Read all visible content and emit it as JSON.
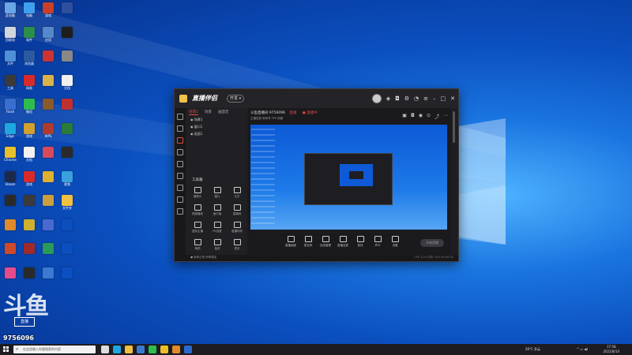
{
  "desktop": {
    "icons": [
      {
        "label": "此电脑",
        "color": "#6aa6e8"
      },
      {
        "label": "电脑",
        "color": "#3fa0f0"
      },
      {
        "label": "游戏",
        "color": "#c8402a"
      },
      {
        "label": "",
        "color": "#2f4f9e"
      },
      {
        "label": "回收站",
        "color": "#cfd6e0"
      },
      {
        "label": "软件",
        "color": "#2a8f4a"
      },
      {
        "label": "应用",
        "color": "#5588cc"
      },
      {
        "label": "",
        "color": "#1e1e1e"
      },
      {
        "label": "文件",
        "color": "#4f8fd8"
      },
      {
        "label": "浏览器",
        "color": "#2c5aa0"
      },
      {
        "label": "",
        "color": "#c33"
      },
      {
        "label": "",
        "color": "#888"
      },
      {
        "label": "工具",
        "color": "#3a3a3a"
      },
      {
        "label": "网易",
        "color": "#d82a2a"
      },
      {
        "label": "",
        "color": "#d9b24a"
      },
      {
        "label": "文档",
        "color": "#f0f0f0"
      },
      {
        "label": "Flash",
        "color": "#3a6ed0"
      },
      {
        "label": "微信",
        "color": "#2dbd4e"
      },
      {
        "label": "",
        "color": "#8a5a2a"
      },
      {
        "label": "",
        "color": "#c03030"
      },
      {
        "label": "Edge",
        "color": "#1ea7e0"
      },
      {
        "label": "游戏",
        "color": "#d0a030"
      },
      {
        "label": "WPS",
        "color": "#b03a2e"
      },
      {
        "label": "",
        "color": "#2a7a3a"
      },
      {
        "label": "Chrome",
        "color": "#e8c02a"
      },
      {
        "label": "文档",
        "color": "#f2f2f2"
      },
      {
        "label": "",
        "color": "#d84a5a"
      },
      {
        "label": "",
        "color": "#2a2a2a"
      },
      {
        "label": "Steam",
        "color": "#1b2a4a"
      },
      {
        "label": "游戏",
        "color": "#d82a2a"
      },
      {
        "label": "",
        "color": "#e0b030"
      },
      {
        "label": "视频",
        "color": "#3aa0e0"
      },
      {
        "label": "",
        "color": "#2a2a2a"
      },
      {
        "label": "",
        "color": "#3a3a3a"
      },
      {
        "label": "",
        "color": "#c8a040"
      },
      {
        "label": "文件夹",
        "color": "#f0c040"
      },
      {
        "label": "",
        "color": "#e08a2a"
      },
      {
        "label": "",
        "color": "#d0b030"
      },
      {
        "label": "",
        "color": "#4a6ad0"
      },
      {
        "label": "",
        "color": "#0b4fbf"
      },
      {
        "label": "",
        "color": "#d04a2a"
      },
      {
        "label": "",
        "color": "#a02a2a"
      },
      {
        "label": "",
        "color": "#2a9a5a"
      },
      {
        "label": "",
        "color": "#0b4fbf"
      },
      {
        "label": "",
        "color": "#e84a8a"
      },
      {
        "label": "",
        "color": "#2a2a2a"
      },
      {
        "label": "",
        "color": "#3a7ad0"
      },
      {
        "label": "",
        "color": "#0b4fbf"
      },
      {
        "label": "",
        "color": "#2a5aa0"
      },
      {
        "label": "",
        "color": "#c02a2a"
      },
      {
        "label": "",
        "color": "#a0a0a0"
      },
      {
        "label": "",
        "color": "#0b4fbf"
      },
      {
        "label": "QQ",
        "color": "#111"
      },
      {
        "label": "",
        "color": "#2a7a9a"
      },
      {
        "label": "",
        "color": "#e0e0e0"
      },
      {
        "label": "",
        "color": "#0b4fbf"
      }
    ],
    "watermark_text": "斗鱼",
    "watermark_tag": "直播",
    "watermark_number": "9756096"
  },
  "app": {
    "name": "直播伴侣",
    "version_badge": "开发 ▾",
    "titlebar_icons": [
      "avatar",
      "shirt-icon",
      "lock-icon",
      "settings-icon",
      "bell-icon",
      "menu-icon",
      "minimize-icon",
      "maximize-icon",
      "close-icon"
    ],
    "tabs": [
      "场景1",
      "场景",
      "画面音"
    ],
    "scenes": [
      "◉ 场景1",
      "◉ 窗口1",
      "◉ 画面1"
    ],
    "tools_title": "工具箱",
    "tools": [
      "摄像头",
      "图片",
      "文字",
      "视频播放",
      "画中画",
      "直播间",
      "虚拟主播",
      "PK连麦",
      "直播特效",
      "美颜",
      "抽奖",
      "更多"
    ],
    "room_title": "斗鱼直播间 9756096",
    "room_badge": "直播",
    "room_status": "● 直播中",
    "room_sub": "主播信息  房间号  FPS  网速",
    "controls": [
      "直播画面",
      "麦克风",
      "连线管理",
      "直播连麦",
      "音效",
      "声卡",
      "设置"
    ],
    "start_label": "开始直播",
    "status_left": "● 帧率正常 码率稳定",
    "status_right": "CPU 12%  内存 35%  00:00:00"
  },
  "taskbar": {
    "search_placeholder": "在这里输入你要搜索的内容",
    "apps": [
      {
        "name": "task-view-icon",
        "color": "#dddddd"
      },
      {
        "name": "edge-icon",
        "color": "#1ea7e0"
      },
      {
        "name": "file-explorer-icon",
        "color": "#f0c040"
      },
      {
        "name": "store-icon",
        "color": "#3a7ad0"
      },
      {
        "name": "wechat-icon",
        "color": "#2dbd4e"
      },
      {
        "name": "chrome-icon",
        "color": "#e8c02a"
      },
      {
        "name": "live-app-icon",
        "color": "#e08a2a"
      },
      {
        "name": "mail-icon",
        "color": "#2a6ad0"
      }
    ],
    "weather": "28°C 多云",
    "clock_time": "17:58",
    "clock_date": "2021/8/10"
  }
}
